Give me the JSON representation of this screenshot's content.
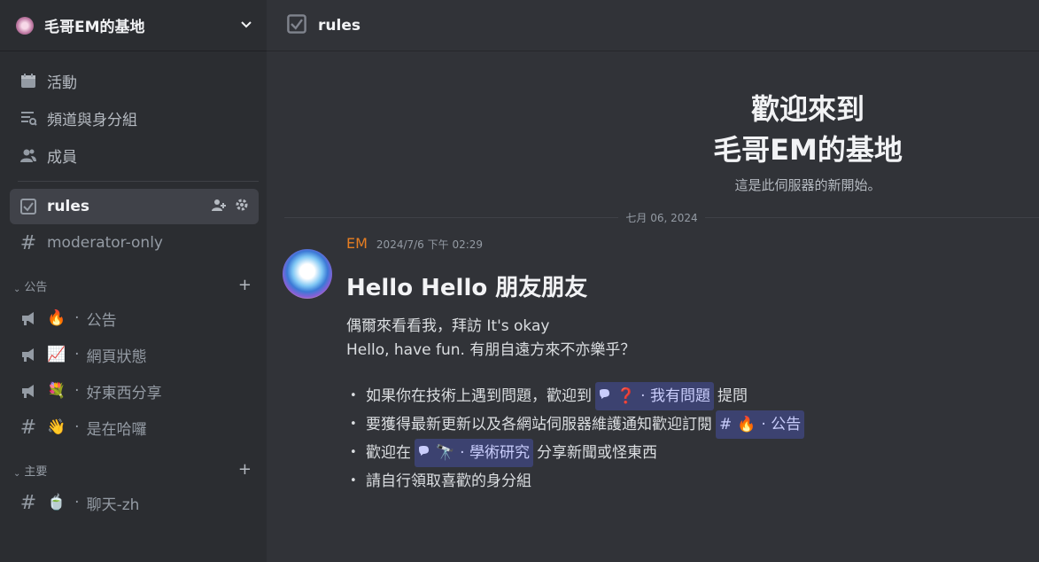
{
  "server": {
    "name": "毛哥EM的基地"
  },
  "nav": {
    "events": "活動",
    "channels_roles": "頻道與身分組",
    "members": "成員"
  },
  "channels_top": [
    {
      "name": "rules",
      "active": true
    },
    {
      "name": "moderator-only",
      "active": false
    }
  ],
  "categories": [
    {
      "name": "公告",
      "channels": [
        {
          "emoji": "🔥",
          "name": "公告"
        },
        {
          "emoji": "📈",
          "name": "網頁狀態"
        },
        {
          "emoji": "💐",
          "name": "好東西分享"
        },
        {
          "emoji": "👋",
          "name": "是在哈囉"
        }
      ]
    },
    {
      "name": "主要",
      "channels": [
        {
          "emoji": "🍵",
          "name": "聊天-zh"
        }
      ]
    }
  ],
  "topbar": {
    "title": "rules"
  },
  "welcome": {
    "line1": "歡迎來到",
    "line2": "毛哥EM的基地",
    "subtitle": "這是此伺服器的新開始。"
  },
  "date_divider": "七月 06, 2024",
  "message": {
    "author": "EM",
    "timestamp": "2024/7/6 下午 02:29",
    "title": "Hello Hello 朋友朋友",
    "body_line1": "偶爾來看看我，拜訪 It's okay",
    "body_line2": "Hello, have fun. 有朋自遠方來不亦樂乎？",
    "list": [
      {
        "pre": "如果你在技術上遇到問題，歡迎到",
        "mention": "· 我有問題",
        "mention_emoji": "❓",
        "post": "提問"
      },
      {
        "pre": "要獲得最新更新以及各網站伺服器維護通知歡迎訂閱",
        "mention": "· 公告",
        "mention_emoji": "🔥",
        "post": ""
      },
      {
        "pre": "歡迎在",
        "mention": "· 學術研究",
        "mention_emoji": "🔭",
        "post": "分享新聞或怪東西"
      },
      {
        "pre": "請自行領取喜歡的身分組",
        "mention": "",
        "mention_emoji": "",
        "post": ""
      }
    ]
  },
  "colors": {
    "sidebar_bg": "#2b2d31",
    "main_bg": "#313338",
    "author": "#e67e22",
    "mention_bg": "#3c4270"
  }
}
